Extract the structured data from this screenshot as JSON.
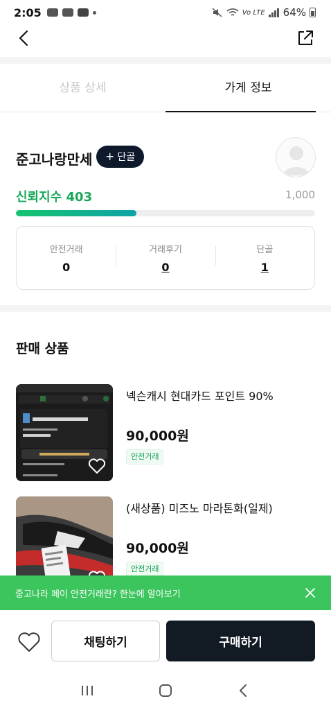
{
  "status_bar": {
    "time": "2:05",
    "battery": "64%",
    "network": "Vo LTE"
  },
  "tabs": [
    {
      "label": "상품 상세",
      "active": false
    },
    {
      "label": "가게 정보",
      "active": true
    }
  ],
  "shop": {
    "name": "준고나랑만세",
    "follow_label": "단골",
    "trust_label": "신뢰지수",
    "trust_value": "403",
    "trust_max": "1,000",
    "trust_fraction": 0.403
  },
  "stats": [
    {
      "label": "안전거래",
      "value": "0",
      "underline": false
    },
    {
      "label": "거래후기",
      "value": "0",
      "underline": true
    },
    {
      "label": "단골",
      "value": "1",
      "underline": true
    }
  ],
  "section": {
    "title": "판매 상품"
  },
  "products": [
    {
      "title": "넥슨캐시 현대카드 포인트 90%",
      "price": "90,000원",
      "badge": "안전거래",
      "thumb": "card-screenshot"
    },
    {
      "title": "(새상품) 미즈노 마라톤화(일제)",
      "price": "90,000원",
      "badge": "안전거래",
      "thumb": "running-shoes"
    }
  ],
  "toast": {
    "text": "중고나라 페이 안전거래란? 한눈에 알아보기"
  },
  "bottom": {
    "chat_label": "채팅하기",
    "buy_label": "구매하기"
  },
  "colors": {
    "accent_green": "#18a85a",
    "toast_green": "#3cc55d",
    "dark_navy": "#121a24"
  },
  "icons": {
    "back": "chevron-left-icon",
    "share": "share-icon",
    "wish": "heart-icon",
    "close": "close-icon"
  }
}
